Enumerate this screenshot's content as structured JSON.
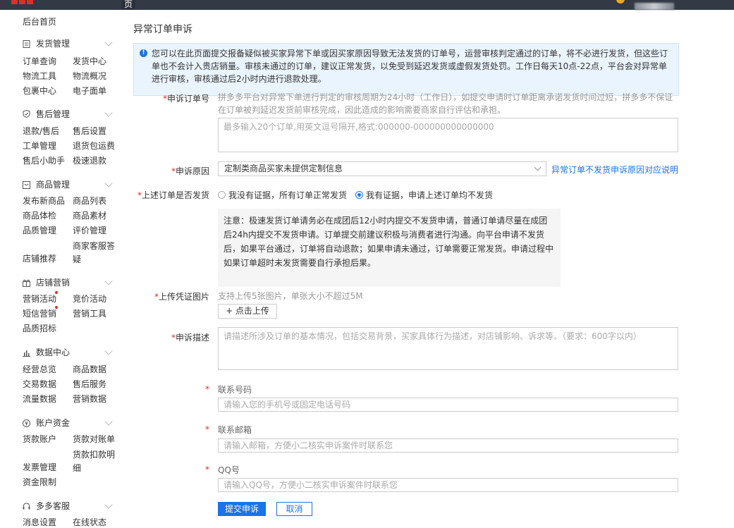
{
  "topbar": {
    "logo": "",
    "page_tab": "页"
  },
  "sidebar": {
    "home": "后台首页",
    "sections": [
      {
        "title": "发货管理",
        "items": [
          "订单查询",
          "发货中心",
          "物流工具",
          "物流概况",
          "包裹中心",
          "电子面单"
        ]
      },
      {
        "title": "售后管理",
        "items": [
          "退款/售后",
          "售后设置",
          "工单管理",
          "退货包运费",
          "售后小助手",
          "极速退款"
        ]
      },
      {
        "title": "商品管理",
        "items": [
          "发布新商品",
          "商品列表",
          "商品体检",
          "商品素材",
          "品质管理",
          "评价管理",
          "店铺推荐",
          "商家客服答疑"
        ]
      },
      {
        "title": "店铺营销",
        "items": [
          "营销活动",
          "竞价活动",
          "短信营销",
          "营销工具",
          "品质招标"
        ]
      },
      {
        "title": "数据中心",
        "items": [
          "经营总览",
          "商品数据",
          "交易数据",
          "售后服务",
          "流量数据",
          "营销数据"
        ]
      },
      {
        "title": "账户资金",
        "items": [
          "货款账户",
          "货款对账单",
          "发票管理",
          "货款扣款明细",
          "资金限制"
        ]
      },
      {
        "title": "多多客服",
        "items": [
          "消息设置",
          "在线状态"
        ]
      }
    ]
  },
  "main": {
    "title": "异常订单申诉",
    "notice": "您可以在此页面提交报备疑似被买家异常下单或因买家原因导致无法发货的订单号，运营审核判定通过的订单，将不必进行发货，但这些订单也不会计入贵店销量。审核未通过的订单，建议正常发货，以免受到延迟发货或虚假发货处罚。工作日每天10点-22点，平台会对异常单进行审核，审核通过后2小时内进行退款处理。",
    "order_label": "申诉订单号",
    "order_hint": "拼多多平台对异常下单进行判定的审核周期为24小时（工作日），如提交申请时订单距离承诺发货时间过短，拼多多不保证在订单被判延迟发货前审核完成，因此造成的影响需要商家自行评估和承担。",
    "order_placeholder": "最多输入20个订单,用英文逗号隔开,格式:000000-000000000000000",
    "reason_label": "申诉原因",
    "reason_value": "定制类商品买家未提供定制信息",
    "reason_link": "异常订单不发货申诉原因对应说明",
    "ship_label": "上述订单是否发货",
    "radio_no": "我没有证据，所有订单正常发货",
    "radio_yes": "我有证据，申请上述订单均不发货",
    "note": "注意：极速发货订单请务必在成团后12小时内提交不发货申请，普通订单请尽量在成团后24h内提交不发货申请。订单提交前建议积极与消费者进行沟通。向平台申请不发货后，如果平台通过，订单将自动退款；如果申请未通过，订单需要正常发货。申请过程中如果订单超时未发货需要自行承担后果。",
    "upload_label": "上传凭证图片",
    "upload_hint": "支持上传5张图片，单张大小不超过5M",
    "upload_btn": "+ 点击上传",
    "desc_label": "申诉描述",
    "desc_placeholder": "请描述所涉及订单的基本情况，包括交易背景，买家具体行为描述，对店铺影响、诉求等。（要求：600字以内）",
    "phone_label": "联系号码",
    "phone_placeholder": "请输入您的手机号或固定电话号码",
    "email_label": "联系邮箱",
    "email_placeholder": "请输入邮箱，方便小二核实申诉案件时联系您",
    "qq_label": "QQ号",
    "qq_placeholder": "请输入QQ号，方便小二核实申诉案件时联系您",
    "submit": "提交申诉",
    "cancel": "取消"
  }
}
